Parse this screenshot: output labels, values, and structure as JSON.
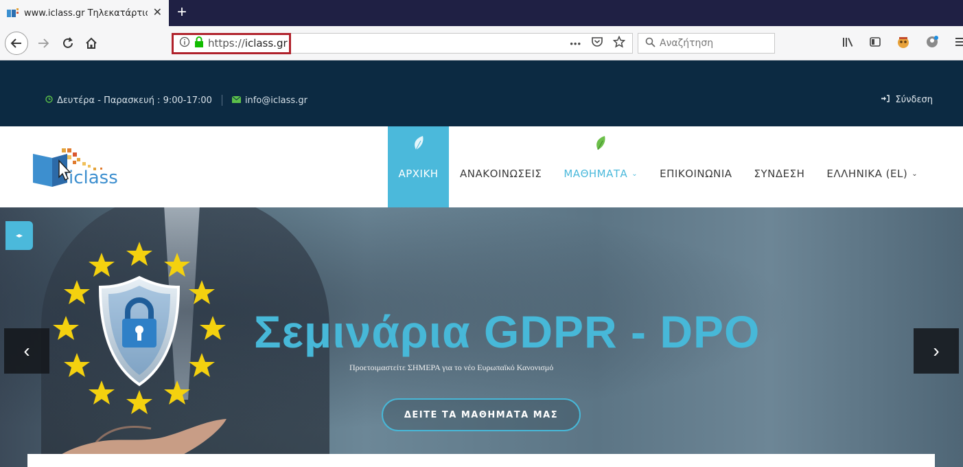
{
  "browser": {
    "tab": {
      "title": "www.iclass.gr Τηλεκατάρτιση -",
      "close_label": "✕",
      "favicon": "iclass-favicon"
    },
    "new_tab_label": "+",
    "nav": {
      "back_icon": "back-arrow-icon",
      "forward_icon": "forward-arrow-icon",
      "reload_icon": "reload-icon",
      "home_icon": "home-icon"
    },
    "url": {
      "protocol": "https://",
      "host": "iclass.gr",
      "info_icon": "info-icon",
      "lock_icon": "lock-icon"
    },
    "url_actions": {
      "more_label": "•••",
      "pocket_icon": "pocket-icon",
      "bookmark_icon": "star-icon"
    },
    "search": {
      "placeholder": "Αναζήτηση",
      "icon": "search-icon"
    },
    "toolbar": [
      "library-icon",
      "sidebar-icon",
      "extension-icon",
      "account-icon",
      "menu-icon"
    ],
    "annotation_color": "#b0212b"
  },
  "topbar": {
    "hours": "Δευτέρα - Παρασκευή : 9:00-17:00",
    "email": "info@iclass.gr",
    "login": "Σύνδεση",
    "background": "#0c2a42",
    "accent": "#5cc04a"
  },
  "header": {
    "logo_text": "iclass",
    "menu": [
      {
        "label": "ΑΡΧΙΚΗ"
      },
      {
        "label": "ΑΝΑΚΟΙΝΩΣΕΙΣ"
      },
      {
        "label": "ΜΑΘΗΜΑΤΑ"
      },
      {
        "label": "ΕΠΙΚΟΙΝΩΝΙΑ"
      },
      {
        "label": "ΣΥΝΔΕΣΗ"
      },
      {
        "label": "ΕΛΛΗΝΙΚΑ (EL)"
      }
    ],
    "accent": "#4bb9db"
  },
  "hero": {
    "title": "Σεμινάρια GDPR - DPO",
    "subtitle": "Προετοιμαστείτε ΣΗΜΕΡΑ για το νέο Ευρωπαϊκό Κανονισμό",
    "cta": "ΔΕΙΤΕ ΤΑ ΜΑΘΗΜΑΤΑ ΜΑΣ",
    "prev_label": "‹",
    "next_label": "›",
    "toggle_label": "◂▸",
    "title_color": "#47b8d8"
  }
}
